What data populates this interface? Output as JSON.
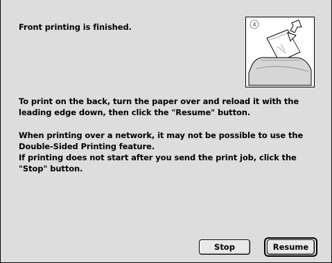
{
  "dialog": {
    "heading": "Front printing is finished.",
    "paragraph1": [
      "To print on the back, turn the paper over and reload it with the",
      "leading edge down, then click the \"Resume\" button."
    ],
    "paragraph2": [
      "When printing over a network, it may not be possible to use the",
      "Double-Sided Printing feature.",
      "If printing does not start after you send the print job, click the",
      "\"Stop\" button."
    ],
    "illustration": {
      "step_number": "4",
      "icon": "printer-reload-paper-icon"
    }
  },
  "buttons": {
    "stop_label": "Stop",
    "resume_label": "Resume",
    "default_button": "Resume"
  },
  "colors": {
    "dialog_background": "#dddddd",
    "text": "#000000"
  }
}
